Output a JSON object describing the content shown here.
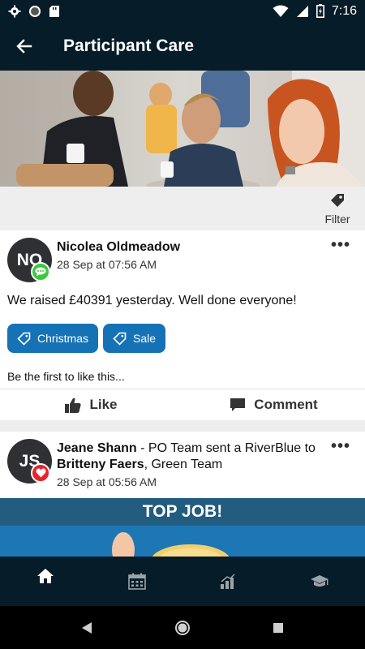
{
  "status_bar": {
    "time": "7:16",
    "icons": [
      "gear-icon",
      "circle-icon",
      "sd-card-icon",
      "wifi-icon",
      "signal-icon",
      "battery-charging-icon"
    ]
  },
  "app_bar": {
    "title": "Participant Care",
    "back_icon": "arrow-left-icon"
  },
  "filter": {
    "label": "Filter",
    "icon": "tag-icon"
  },
  "posts": [
    {
      "avatar_initials": "NO",
      "badge_icon": "chat-bubble-icon",
      "badge_color": "#3cc83c",
      "author": "Nicolea Oldmeadow",
      "timestamp": "28 Sep at 07:56 AM",
      "text": "We raised £40391 yesterday. Well done everyone!",
      "tags": [
        "Christmas",
        "Sale"
      ],
      "likes_text": "Be the first to like this...",
      "actions": {
        "like": "Like",
        "comment": "Comment"
      }
    },
    {
      "avatar_initials": "JS",
      "badge_icon": "heart-icon",
      "badge_color": "#e8232a",
      "author": "Jeane Shann",
      "text_middle": " - PO Team sent a RiverBlue to ",
      "recipient": "Britteny Faers",
      "text_end": ", Green Team",
      "timestamp": "28 Sep at 05:56 AM",
      "banner_title": "TOP JOB!"
    }
  ],
  "bottom_nav": {
    "items": [
      "home-icon",
      "calendar-icon",
      "chart-icon",
      "graduation-cap-icon"
    ],
    "active": "home-icon"
  },
  "system_nav": [
    "back-triangle-icon",
    "home-circle-icon",
    "recents-square-icon"
  ],
  "colors": {
    "app_bar": "#061c28",
    "tag_chip": "#1573b5",
    "like_badge": "#3cc83c",
    "heart_badge": "#e8232a"
  }
}
